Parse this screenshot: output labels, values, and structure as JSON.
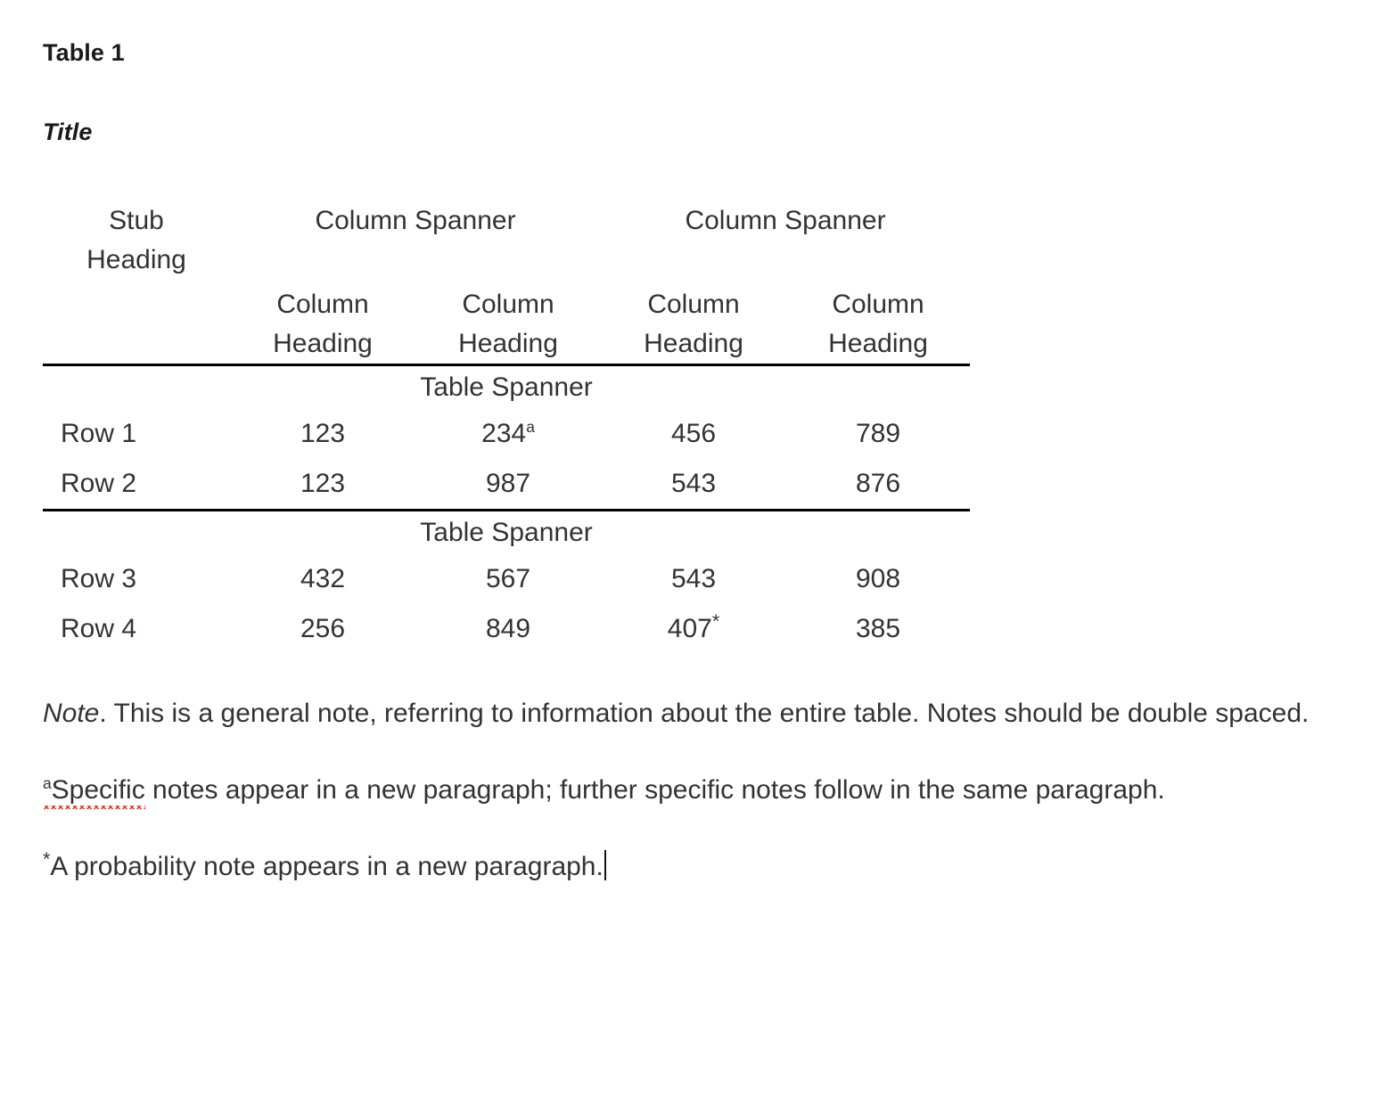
{
  "document": {
    "table_number": "Table 1",
    "title": "Title"
  },
  "table": {
    "stub_heading": {
      "line1": "Stub",
      "line2": "Heading"
    },
    "column_spanners": [
      "Column Spanner",
      "Column Spanner"
    ],
    "column_headings": [
      {
        "line1": "Column",
        "line2": "Heading"
      },
      {
        "line1": "Column",
        "line2": "Heading"
      },
      {
        "line1": "Column",
        "line2": "Heading"
      },
      {
        "line1": "Column",
        "line2": "Heading"
      }
    ],
    "sections": [
      {
        "table_spanner": "Table Spanner",
        "rows": [
          {
            "label": "Row 1",
            "values": [
              "123",
              "234",
              "456",
              "789"
            ],
            "marks": [
              "",
              "a",
              "",
              ""
            ]
          },
          {
            "label": "Row 2",
            "values": [
              "123",
              "987",
              "543",
              "876"
            ],
            "marks": [
              "",
              "",
              "",
              ""
            ]
          }
        ]
      },
      {
        "table_spanner": "Table Spanner",
        "rows": [
          {
            "label": "Row 3",
            "values": [
              "432",
              "567",
              "543",
              "908"
            ],
            "marks": [
              "",
              "",
              "",
              ""
            ]
          },
          {
            "label": "Row 4",
            "values": [
              "256",
              "849",
              "407",
              "385"
            ],
            "marks": [
              "",
              "",
              "*",
              ""
            ]
          }
        ]
      }
    ]
  },
  "notes": {
    "general": {
      "lead": "Note",
      "text": ". This is a general note, referring to information about the entire table. Notes should be double spaced."
    },
    "specific": {
      "mark": "a",
      "misspelled_word": "Specific",
      "text": " notes appear in a new paragraph; further specific notes follow in the same paragraph."
    },
    "probability": {
      "mark": "*",
      "text": "A probability note appears in a new paragraph."
    }
  },
  "colors": {
    "text": "#333333",
    "heading": "#1a1a1a",
    "rule": "#000000",
    "spellcheck_underline": "#e03020",
    "caret": "#111111"
  }
}
